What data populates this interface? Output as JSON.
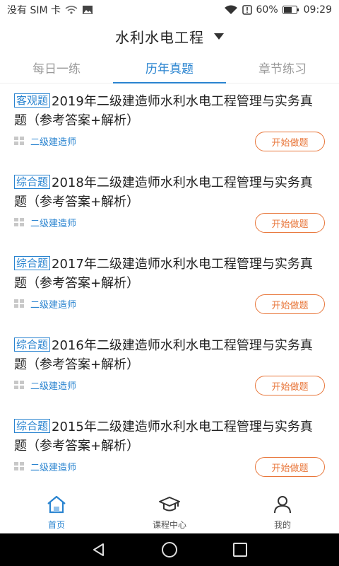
{
  "status_bar": {
    "carrier": "没有 SIM 卡",
    "battery": "60%",
    "time": "09:29"
  },
  "header": {
    "title": "水利水电工程"
  },
  "tabs": [
    {
      "label": "每日一练",
      "active": false
    },
    {
      "label": "历年真题",
      "active": true
    },
    {
      "label": "章节练习",
      "active": false
    }
  ],
  "items": [
    {
      "tag": "客观题",
      "title": "2019年二级建造师水利水电工程管理与实务真题（参考答案+解析）",
      "category": "二级建造师",
      "button": "开始做题"
    },
    {
      "tag": "综合题",
      "title": "2018年二级建造师水利水电工程管理与实务真题（参考答案+解析）",
      "category": "二级建造师",
      "button": "开始做题"
    },
    {
      "tag": "综合题",
      "title": "2017年二级建造师水利水电工程管理与实务真题（参考答案+解析）",
      "category": "二级建造师",
      "button": "开始做题"
    },
    {
      "tag": "综合题",
      "title": "2016年二级建造师水利水电工程管理与实务真题（参考答案+解析）",
      "category": "二级建造师",
      "button": "开始做题"
    },
    {
      "tag": "综合题",
      "title": "2015年二级建造师水利水电工程管理与实务真题（参考答案+解析）",
      "category": "二级建造师",
      "button": "开始做题"
    }
  ],
  "bottom_nav": [
    {
      "label": "首页",
      "icon": "home-icon",
      "active": true
    },
    {
      "label": "课程中心",
      "icon": "graduation-cap-icon",
      "active": false
    },
    {
      "label": "我的",
      "icon": "user-icon",
      "active": false
    }
  ],
  "colors": {
    "accent": "#2a84d0",
    "button": "#e8763a"
  }
}
